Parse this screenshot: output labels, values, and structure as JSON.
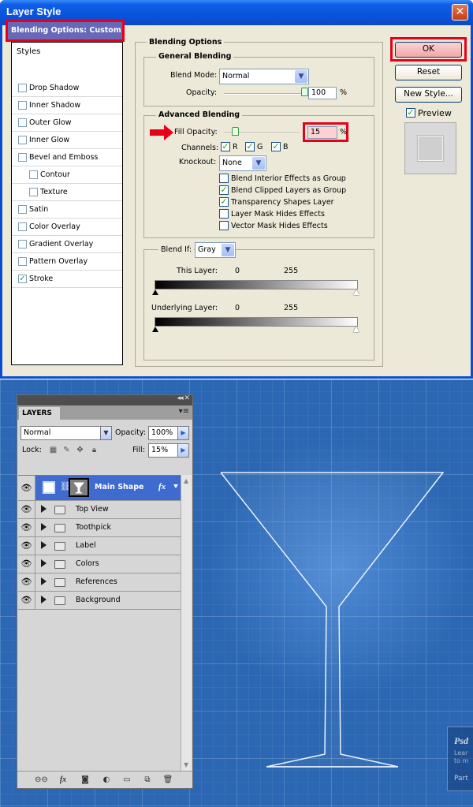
{
  "dialog": {
    "title": "Layer Style",
    "close_label": "✕",
    "styles_header": "Styles",
    "active_style": "Blending Options: Custom",
    "style_items": [
      {
        "label": "Drop Shadow",
        "checked": false,
        "sub": false
      },
      {
        "label": "Inner Shadow",
        "checked": false,
        "sub": false
      },
      {
        "label": "Outer Glow",
        "checked": false,
        "sub": false
      },
      {
        "label": "Inner Glow",
        "checked": false,
        "sub": false
      },
      {
        "label": "Bevel and Emboss",
        "checked": false,
        "sub": false
      },
      {
        "label": "Contour",
        "checked": false,
        "sub": true
      },
      {
        "label": "Texture",
        "checked": false,
        "sub": true
      },
      {
        "label": "Satin",
        "checked": false,
        "sub": false
      },
      {
        "label": "Color Overlay",
        "checked": false,
        "sub": false
      },
      {
        "label": "Gradient Overlay",
        "checked": false,
        "sub": false
      },
      {
        "label": "Pattern Overlay",
        "checked": false,
        "sub": false
      },
      {
        "label": "Stroke",
        "checked": true,
        "sub": false
      }
    ],
    "blending_options_title": "Blending Options",
    "general_blending_title": "General Blending",
    "blend_mode_label": "Blend Mode:",
    "blend_mode_value": "Normal",
    "opacity_label": "Opacity:",
    "opacity_value": "100",
    "opacity_fraction": 1.0,
    "percent": "%",
    "advanced_blending_title": "Advanced Blending",
    "fill_opacity_label": "Fill Opacity:",
    "fill_opacity_value": "15",
    "fill_opacity_fraction": 0.15,
    "channels_label": "Channels:",
    "channel_r": "R",
    "channel_g": "G",
    "channel_b": "B",
    "knockout_label": "Knockout:",
    "knockout_value": "None",
    "options": [
      {
        "label": "Blend Interior Effects as Group",
        "checked": false
      },
      {
        "label": "Blend Clipped Layers as Group",
        "checked": true
      },
      {
        "label": "Transparency Shapes Layer",
        "checked": true
      },
      {
        "label": "Layer Mask Hides Effects",
        "checked": false
      },
      {
        "label": "Vector Mask Hides Effects",
        "checked": false
      }
    ],
    "blend_if_label": "Blend If:",
    "blend_if_value": "Gray",
    "this_layer_label": "This Layer:",
    "underlying_layer_label": "Underlying Layer:",
    "range_low": "0",
    "range_high": "255",
    "ok_label": "OK",
    "reset_label": "Reset",
    "new_style_label": "New Style...",
    "preview_label": "Preview",
    "preview_checked": true,
    "accent_color": "#e8001a"
  },
  "layers_panel": {
    "tab_label": "LAYERS",
    "blend_mode": "Normal",
    "opacity_label": "Opacity:",
    "opacity_value": "100%",
    "lock_label": "Lock:",
    "fill_label": "Fill:",
    "fill_value": "15%",
    "selected_layer": {
      "name": "Main Shape",
      "fx": "fx"
    },
    "groups": [
      "Top View",
      "Toothpick",
      "Label",
      "Colors",
      "References",
      "Background"
    ],
    "selection_color": "#3f6bd1"
  },
  "canvas": {
    "background_color": "#2b67b2",
    "badge_title": "Psd",
    "badge_sub": "Lear\nto m",
    "badge_part": "Part"
  }
}
